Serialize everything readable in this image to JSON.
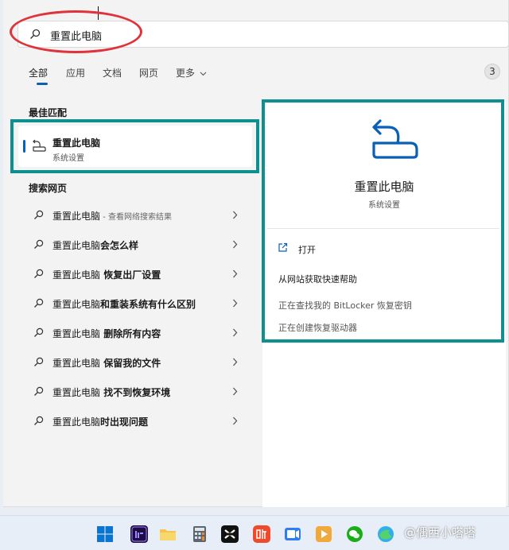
{
  "search": {
    "value": "重置此电脑"
  },
  "tabs": [
    {
      "label": "全部"
    },
    {
      "label": "应用"
    },
    {
      "label": "文档"
    },
    {
      "label": "网页"
    },
    {
      "label": "更多"
    }
  ],
  "result_count": "3",
  "best_match": {
    "heading": "最佳匹配",
    "title": "重置此电脑",
    "subtitle": "系统设置"
  },
  "web": {
    "heading": "搜索网页",
    "results": [
      {
        "main": "重置此电脑",
        "suffix": " - 查看网络搜索结果"
      },
      {
        "main": "重置此电脑",
        "bold": "会怎么样"
      },
      {
        "main": "重置此电脑",
        "bold": " 恢复出厂设置"
      },
      {
        "main": "重置此电脑",
        "bold": "和重装系统有什么区别"
      },
      {
        "main": "重置此电脑",
        "bold": " 删除所有内容"
      },
      {
        "main": "重置此电脑",
        "bold": " 保留我的文件"
      },
      {
        "main": "重置此电脑",
        "bold": " 找不到恢复环境"
      },
      {
        "main": "重置此电脑",
        "bold": "时出现问题"
      }
    ]
  },
  "detail": {
    "title": "重置此电脑",
    "subtitle": "系统设置",
    "open_label": "打开",
    "help_heading": "从网站获取快速帮助",
    "links": [
      "正在查找我的 BitLocker 恢复密钥",
      "正在创建恢复驱动器"
    ]
  },
  "watermark": "@偶西小嗒嗒",
  "colors": {
    "accent": "#0b5fb4",
    "highlight_box": "#0f9090",
    "highlight_oval": "#e0323a"
  },
  "taskbar_icons": [
    "windows-start",
    "premiere-pro",
    "file-explorer",
    "calculator",
    "capcut",
    "ting-app",
    "video-app",
    "media-player",
    "wechat",
    "browser"
  ]
}
